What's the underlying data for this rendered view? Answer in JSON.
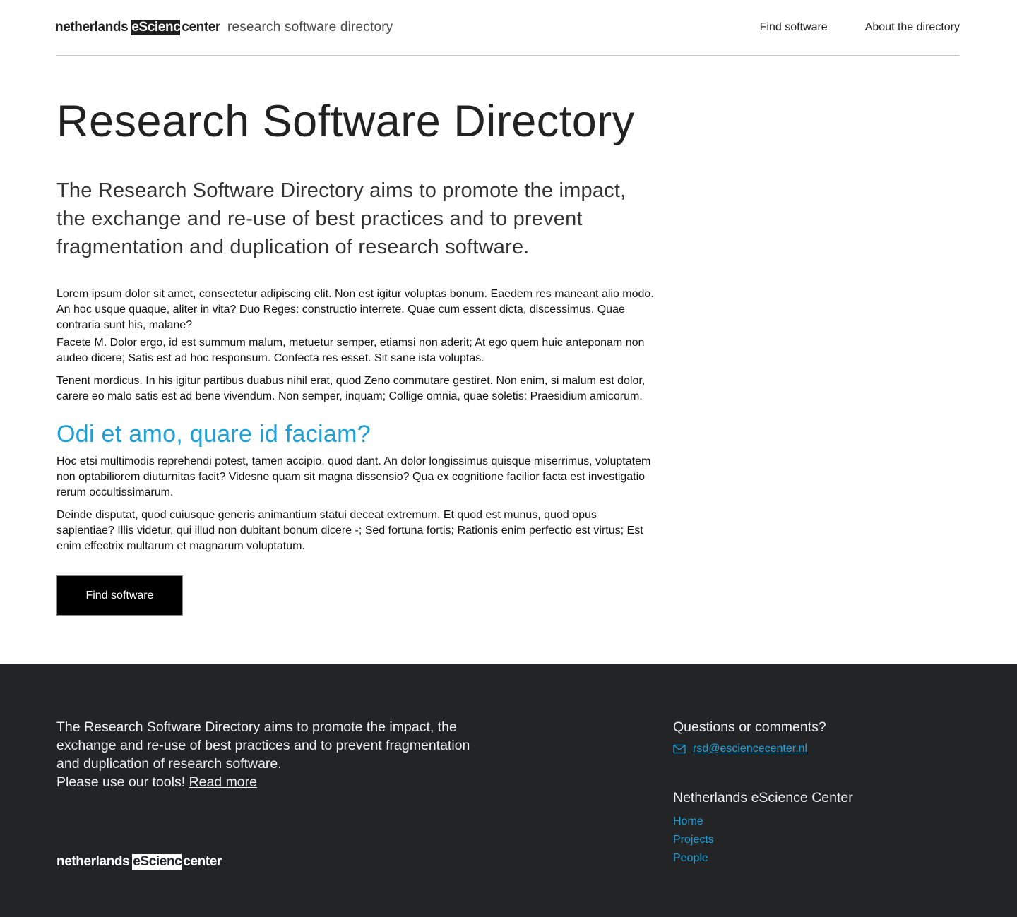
{
  "header": {
    "logo": {
      "pre": "netherlands",
      "box": "eScience",
      "post": "center"
    },
    "subtitle": "research software directory",
    "nav": [
      "Find software",
      "About the directory"
    ]
  },
  "main": {
    "title": "Research Software Directory",
    "lead": "The Research Software Directory aims to promote the impact, the exchange and re-use of best practices and to prevent fragmentation and duplication of research software.",
    "paragraphs": [
      "Lorem ipsum dolor sit amet, consectetur adipiscing elit. Non est igitur voluptas bonum. Eaedem res maneant alio modo. An hoc usque quaque, aliter in vita? Duo Reges: constructio interrete. Quae cum essent dicta, discessimus. Quae contraria sunt his, malane?",
      "Facete M. Dolor ergo, id est summum malum, metuetur semper, etiamsi non aderit; At ego quem huic anteponam non audeo dicere; Satis est ad hoc responsum. Confecta res esset. Sit sane ista voluptas.",
      "Tenent mordicus. In his igitur partibus duabus nihil erat, quod Zeno commutare gestiret. Non enim, si malum est dolor, carere eo malo satis est ad bene vivendum. Non semper, inquam; Collige omnia, quae soletis: Praesidium amicorum."
    ],
    "subheading": "Odi et amo, quare id faciam?",
    "paragraphs2": [
      "Hoc etsi multimodis reprehendi potest, tamen accipio, quod dant. An dolor longissimus quisque miserrimus, voluptatem non optabiliorem diuturnitas facit? Videsne quam sit magna dissensio? Qua ex cognitione facilior facta est investigatio rerum occultissimarum.",
      "Deinde disputat, quod cuiusque generis animantium statui deceat extremum. Et quod est munus, quod opus sapientiae? Illis videtur, qui illud non dubitant bonum dicere -; Sed fortuna fortis; Rationis enim perfectio est virtus; Est enim effectrix multarum et magnarum voluptatum."
    ],
    "button": "Find software"
  },
  "footer": {
    "text": "The Research Software Directory aims to promote the impact, the exchange and re-use of best practices and to prevent fragmentation and duplication of research software.",
    "tools_prefix": "Please use our tools!",
    "read_more": "Read more",
    "logo": {
      "pre": "netherlands",
      "box": "eScience",
      "post": "center"
    },
    "questions": "Questions or comments?",
    "email": "rsd@esciencecenter.nl",
    "org": "Netherlands eScience Center",
    "links": [
      "Home",
      "Projects",
      "People"
    ]
  },
  "colors": {
    "accent": "#1f9fd8",
    "footer_bg": "#232426",
    "button_bg": "#000000"
  },
  "icons": {
    "email": "envelope-icon"
  }
}
